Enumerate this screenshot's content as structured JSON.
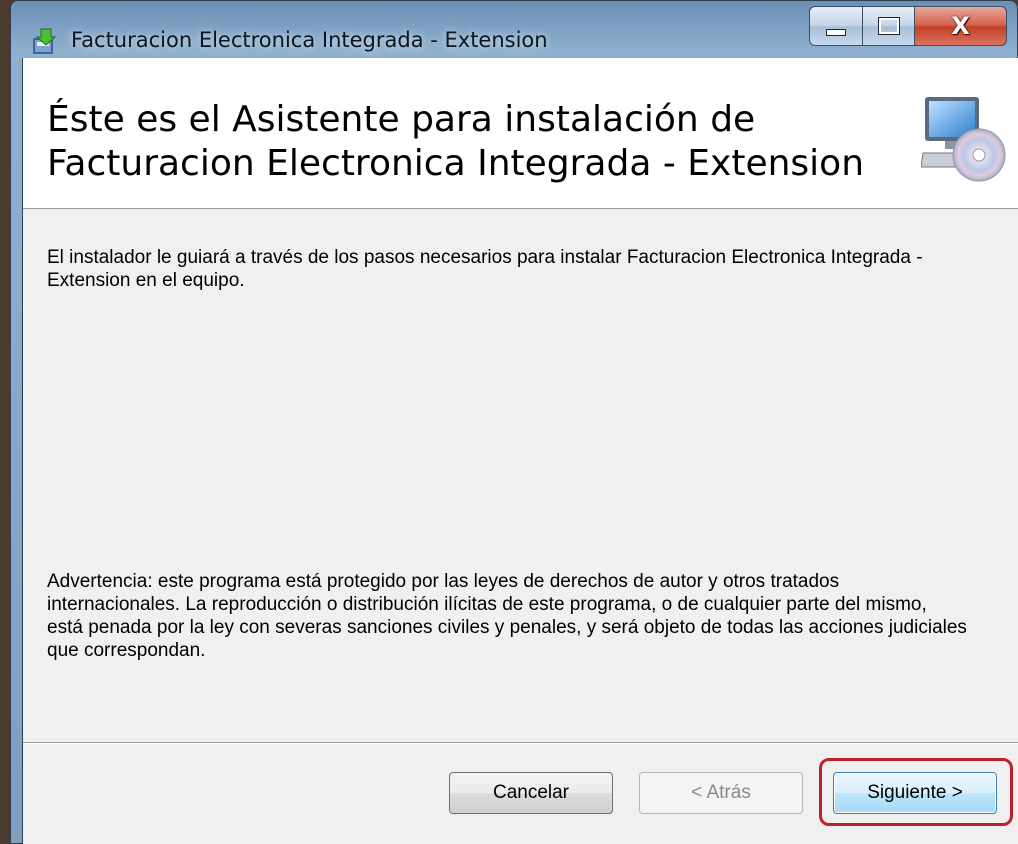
{
  "window": {
    "title": "Facturacion Electronica Integrada - Extension",
    "close_label": "X"
  },
  "banner": {
    "title": "Éste es el Asistente para instalación de Facturacion Electronica Integrada - Extension",
    "icon": "computer-cd-icon"
  },
  "content": {
    "intro": "El instalador le guiará a través de los pasos necesarios para instalar Facturacion Electronica Integrada - Extension en el equipo.",
    "warning": "Advertencia: este programa está protegido por las leyes de derechos de autor y otros tratados internacionales. La reproducción o distribución ilícitas de este programa, o de cualquier parte del mismo, está penada por la ley con severas sanciones civiles y penales, y será objeto de todas las acciones judiciales que correspondan."
  },
  "buttons": {
    "cancel": "Cancelar",
    "back": "< Atrás",
    "next": "Siguiente >"
  },
  "colors": {
    "highlight": "#c0202a",
    "dialog_bg": "#f0f0f0"
  }
}
